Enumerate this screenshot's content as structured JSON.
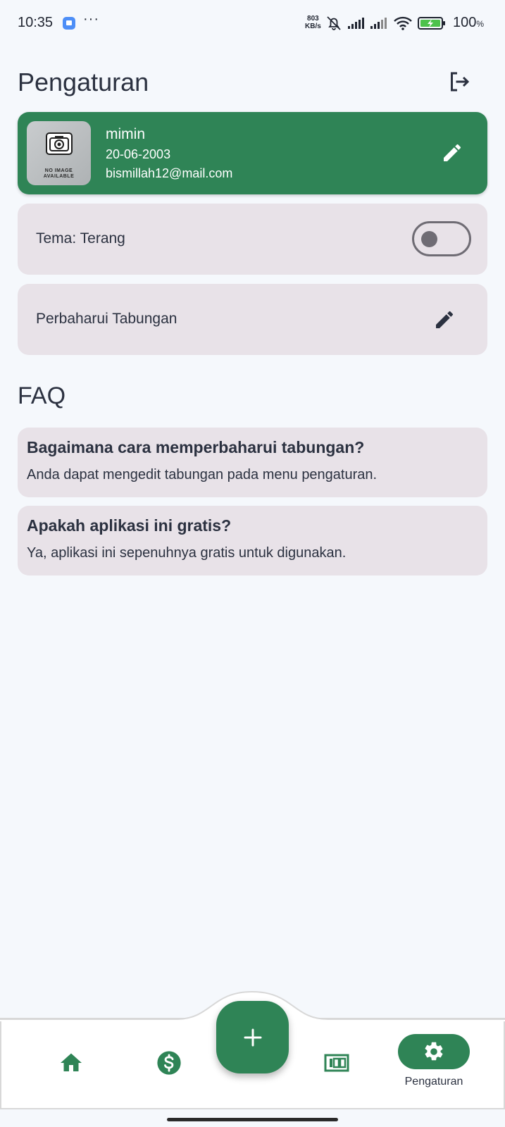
{
  "status_bar": {
    "time": "10:35",
    "dots": "···",
    "speed_value": "803",
    "speed_unit": "KB/s",
    "battery_percent": "100",
    "battery_unit": "%"
  },
  "header": {
    "title": "Pengaturan",
    "logout_icon": "logout-icon"
  },
  "profile": {
    "name": "mimin",
    "birth_date": "20-06-2003",
    "email": "bismillah12@mail.com",
    "avatar_line1": "NO IMAGE",
    "avatar_line2": "AVAILABLE",
    "edit_icon": "pencil-icon"
  },
  "settings": {
    "theme_label": "Tema: Terang",
    "theme_dark_enabled": false,
    "savings_label": "Perbaharui Tabungan"
  },
  "faq": {
    "title": "FAQ",
    "items": [
      {
        "question": "Bagaimana cara memperbaharui tabungan?",
        "answer": "Anda dapat mengedit tabungan pada menu pengaturan."
      },
      {
        "question": "Apakah aplikasi ini gratis?",
        "answer": "Ya, aplikasi ini sepenuhnya gratis untuk digunakan."
      }
    ]
  },
  "bottom_nav": {
    "fab_label": "+",
    "settings_label": "Pengaturan",
    "active": "settings"
  },
  "colors": {
    "primary": "#2f8456",
    "background": "#f5f8fc",
    "card": "#e8e2e8",
    "text": "#2b3140"
  }
}
